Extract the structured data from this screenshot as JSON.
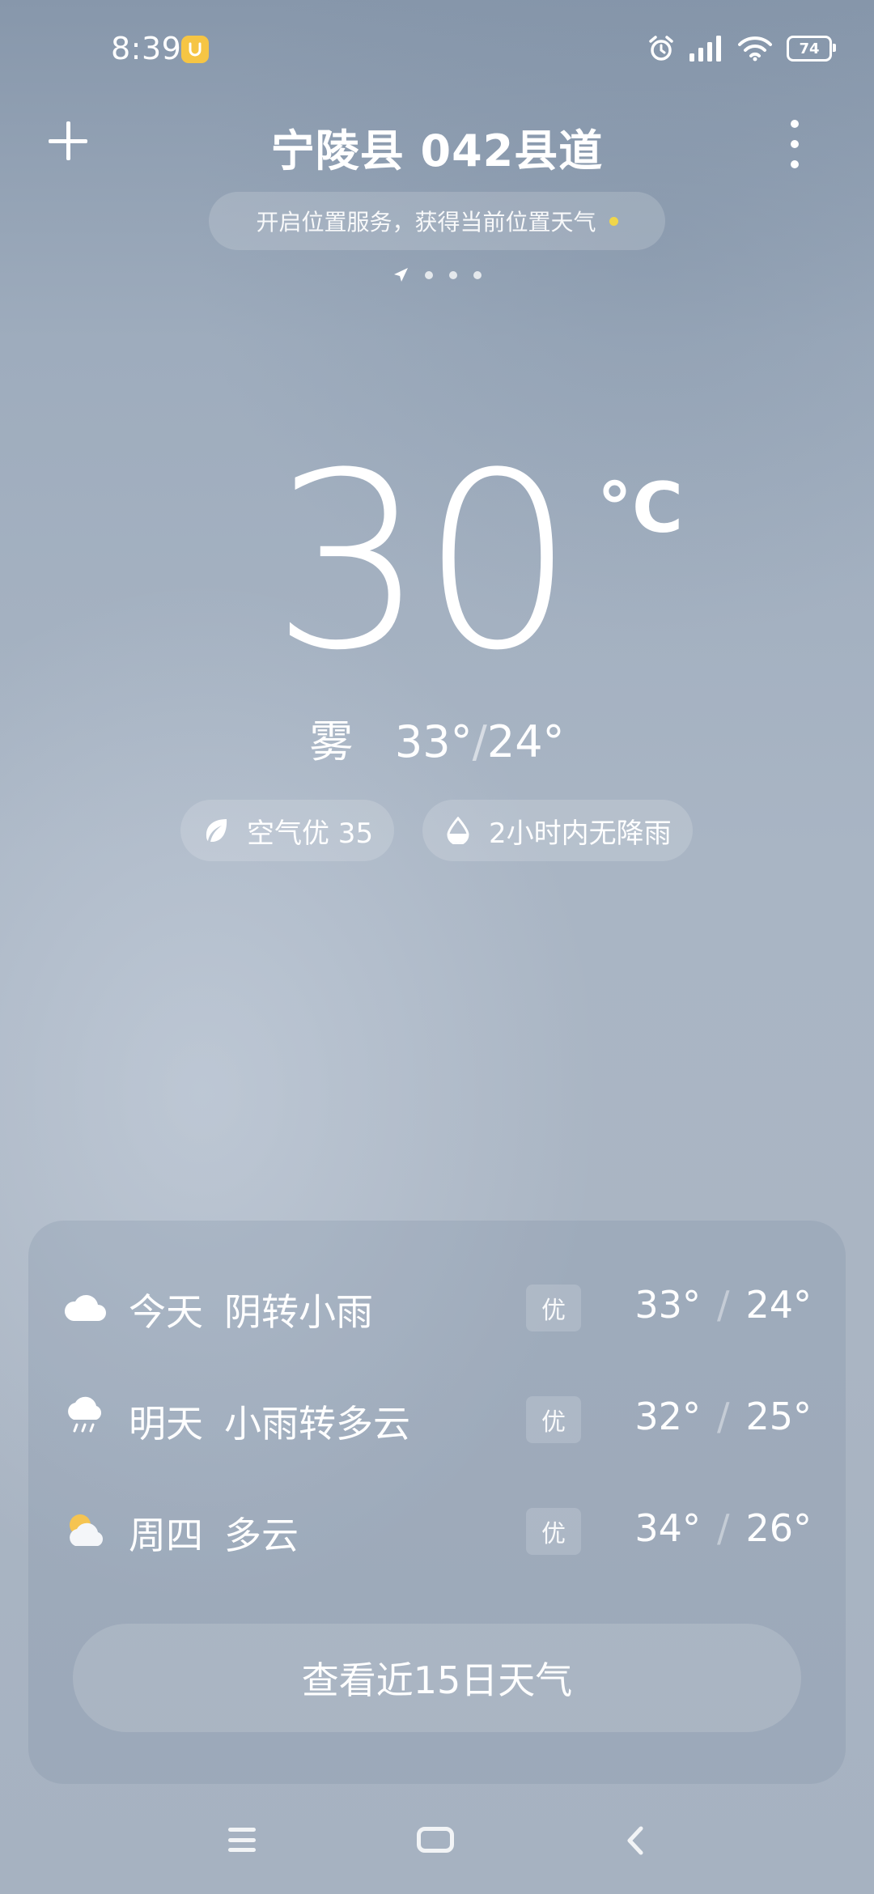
{
  "status_bar": {
    "time": "8:39",
    "battery": "74",
    "icons": [
      "alarm-icon",
      "signal-icon",
      "wifi-icon",
      "battery-icon"
    ]
  },
  "header": {
    "city": "宁陵县 042县道",
    "location_prompt": "开启位置服务，获得当前位置天气",
    "page_count": 3
  },
  "current": {
    "temperature": "30",
    "unit": "°C",
    "condition": "雾",
    "high": "33°",
    "slash": "/",
    "low": "24°",
    "air_quality": "空气优 35",
    "rain_forecast": "2小时内无降雨"
  },
  "forecast": [
    {
      "day": "今天",
      "condition": "阴转小雨",
      "aqi": "优",
      "high": "33°",
      "low": "24°",
      "icon": "cloudy-icon"
    },
    {
      "day": "明天",
      "condition": "小雨转多云",
      "aqi": "优",
      "high": "32°",
      "low": "25°",
      "icon": "light-rain-icon"
    },
    {
      "day": "周四",
      "condition": "多云",
      "aqi": "优",
      "high": "34°",
      "low": "26°",
      "icon": "partly-cloudy-icon"
    }
  ],
  "forecast_slash": "/",
  "cta_label": "查看近15日天气",
  "colors": {
    "background_top": "#8797ab",
    "background_bottom": "#a6b2c1",
    "location_dot": "#f0d64a",
    "sun": "#f5c451"
  }
}
